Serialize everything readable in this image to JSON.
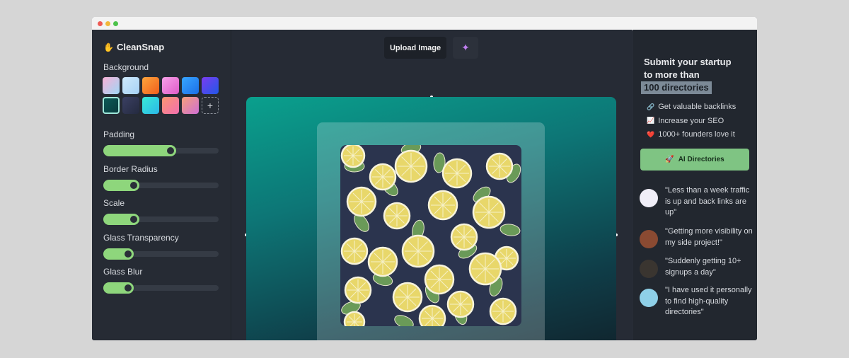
{
  "brand": {
    "name": "CleanSnap",
    "icon": "hand-icon"
  },
  "left": {
    "background_label": "Background",
    "swatches": [
      {
        "colors": [
          "#f7b0d6",
          "#9fd7f6"
        ]
      },
      {
        "colors": [
          "#cde9fb",
          "#a7d2f6"
        ]
      },
      {
        "colors": [
          "#fca53c",
          "#f25f1c"
        ]
      },
      {
        "colors": [
          "#f6a1e8",
          "#e05bc8"
        ]
      },
      {
        "colors": [
          "#37a6ff",
          "#1c6fe8"
        ]
      },
      {
        "colors": [
          "#7b3cf0",
          "#2158e8"
        ]
      },
      {
        "colors": [
          "#0b5a57",
          "#0a3b3e"
        ],
        "selected": true
      },
      {
        "colors": [
          "#3b4063",
          "#242a3f"
        ]
      },
      {
        "colors": [
          "#39ead6",
          "#2bb7e8"
        ]
      },
      {
        "colors": [
          "#fb9670",
          "#f26fb0"
        ]
      },
      {
        "colors": [
          "#f5a07a",
          "#cf6fd5"
        ]
      }
    ],
    "add_swatch": "+",
    "sliders": [
      {
        "label": "Padding",
        "value": 0.62
      },
      {
        "label": "Border Radius",
        "value": 0.3
      },
      {
        "label": "Scale",
        "value": 0.3
      },
      {
        "label": "Glass Transparency",
        "value": 0.25
      },
      {
        "label": "Glass Blur",
        "value": 0.25
      }
    ]
  },
  "main": {
    "upload_label": "Upload Image",
    "sparkle_icon": "sparkle-icon"
  },
  "right": {
    "promo_line1": "Submit your startup",
    "promo_line2": "to more than",
    "promo_highlight": "100 directories",
    "bullets": [
      {
        "icon": "🔗",
        "text": "Get valuable backlinks"
      },
      {
        "icon": "📈",
        "text": "Increase your SEO"
      },
      {
        "icon": "❤️",
        "text": "1000+ founders love it"
      }
    ],
    "cta_label": "AI Directories",
    "testimonials": [
      {
        "quote": "\"Less than a week traffic is up and back links are up\"",
        "avatar_color": "#f0eef8"
      },
      {
        "quote": "\"Getting more visibility on my side project!\"",
        "avatar_color": "#8a4a32"
      },
      {
        "quote": "\"Suddenly getting 10+ signups a day\"",
        "avatar_color": "#3a3530"
      },
      {
        "quote": "\"I have used it personally to find high-quality directories\"",
        "avatar_color": "#8fd0e8"
      }
    ]
  }
}
